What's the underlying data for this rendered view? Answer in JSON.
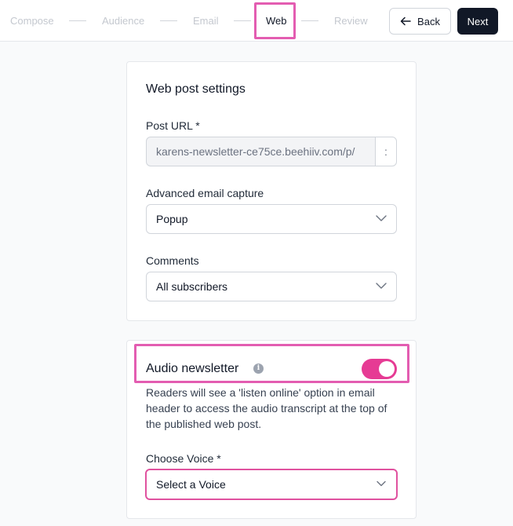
{
  "steps": {
    "compose": "Compose",
    "audience": "Audience",
    "email": "Email",
    "web": "Web",
    "review": "Review"
  },
  "nav": {
    "back_label": "Back",
    "next_label": "Next"
  },
  "web_settings": {
    "title": "Web post settings",
    "post_url_label": "Post URL *",
    "post_url_value": "karens-newsletter-ce75ce.beehiiv.com/p/",
    "post_url_tail": ":",
    "email_capture_label": "Advanced email capture",
    "email_capture_value": "Popup",
    "comments_label": "Comments",
    "comments_value": "All subscribers"
  },
  "audio": {
    "title": "Audio newsletter",
    "enabled": true,
    "toggle_color": "#e63b94",
    "description": "Readers will see a 'listen online' option in email header to access the audio transcript at the top of the published web post.",
    "voice_label": "Choose Voice *",
    "voice_placeholder": "Select a Voice"
  },
  "colors": {
    "highlight": "#e35db1",
    "primary_button": "#111827"
  }
}
